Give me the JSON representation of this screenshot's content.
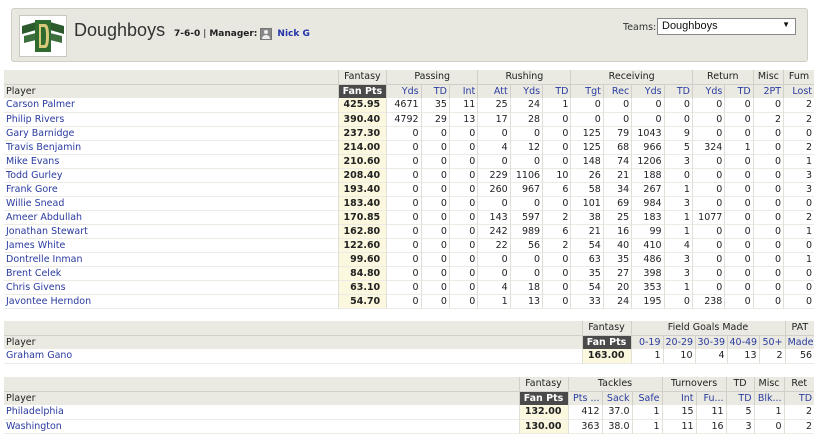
{
  "team": {
    "name": "Doughboys",
    "record": "7-6-0",
    "manager_label": "Manager:",
    "manager_name": "Nick G"
  },
  "teams_selector": {
    "label": "Teams:",
    "selected": "Doughboys"
  },
  "offense": {
    "group_headers": [
      "Fantasy",
      "Passing",
      "Rushing",
      "Receiving",
      "Return",
      "Misc",
      "Fum"
    ],
    "columns": [
      "Player",
      "Fan Pts",
      "Yds",
      "TD",
      "Int",
      "Att",
      "Yds",
      "TD",
      "Tgt",
      "Rec",
      "Yds",
      "TD",
      "Yds",
      "TD",
      "2PT",
      "Lost"
    ],
    "rows": [
      [
        "Carson Palmer",
        "425.95",
        "4671",
        "35",
        "11",
        "25",
        "24",
        "1",
        "0",
        "0",
        "0",
        "0",
        "0",
        "0",
        "0",
        "2"
      ],
      [
        "Philip Rivers",
        "390.40",
        "4792",
        "29",
        "13",
        "17",
        "28",
        "0",
        "0",
        "0",
        "0",
        "0",
        "0",
        "0",
        "2",
        "2"
      ],
      [
        "Gary Barnidge",
        "237.30",
        "0",
        "0",
        "0",
        "0",
        "0",
        "0",
        "125",
        "79",
        "1043",
        "9",
        "0",
        "0",
        "0",
        "0"
      ],
      [
        "Travis Benjamin",
        "214.00",
        "0",
        "0",
        "0",
        "4",
        "12",
        "0",
        "125",
        "68",
        "966",
        "5",
        "324",
        "1",
        "0",
        "2"
      ],
      [
        "Mike Evans",
        "210.60",
        "0",
        "0",
        "0",
        "0",
        "0",
        "0",
        "148",
        "74",
        "1206",
        "3",
        "0",
        "0",
        "0",
        "1"
      ],
      [
        "Todd Gurley",
        "208.40",
        "0",
        "0",
        "0",
        "229",
        "1106",
        "10",
        "26",
        "21",
        "188",
        "0",
        "0",
        "0",
        "0",
        "3"
      ],
      [
        "Frank Gore",
        "193.40",
        "0",
        "0",
        "0",
        "260",
        "967",
        "6",
        "58",
        "34",
        "267",
        "1",
        "0",
        "0",
        "0",
        "3"
      ],
      [
        "Willie Snead",
        "183.40",
        "0",
        "0",
        "0",
        "0",
        "0",
        "0",
        "101",
        "69",
        "984",
        "3",
        "0",
        "0",
        "0",
        "0"
      ],
      [
        "Ameer Abdullah",
        "170.85",
        "0",
        "0",
        "0",
        "143",
        "597",
        "2",
        "38",
        "25",
        "183",
        "1",
        "1077",
        "0",
        "0",
        "2"
      ],
      [
        "Jonathan Stewart",
        "162.80",
        "0",
        "0",
        "0",
        "242",
        "989",
        "6",
        "21",
        "16",
        "99",
        "1",
        "0",
        "0",
        "0",
        "1"
      ],
      [
        "James White",
        "122.60",
        "0",
        "0",
        "0",
        "22",
        "56",
        "2",
        "54",
        "40",
        "410",
        "4",
        "0",
        "0",
        "0",
        "0"
      ],
      [
        "Dontrelle Inman",
        "99.60",
        "0",
        "0",
        "0",
        "0",
        "0",
        "0",
        "63",
        "35",
        "486",
        "3",
        "0",
        "0",
        "0",
        "1"
      ],
      [
        "Brent Celek",
        "84.80",
        "0",
        "0",
        "0",
        "0",
        "0",
        "0",
        "35",
        "27",
        "398",
        "3",
        "0",
        "0",
        "0",
        "0"
      ],
      [
        "Chris Givens",
        "63.10",
        "0",
        "0",
        "0",
        "4",
        "18",
        "0",
        "54",
        "20",
        "353",
        "1",
        "0",
        "0",
        "0",
        "0"
      ],
      [
        "Javontee Herndon",
        "54.70",
        "0",
        "0",
        "0",
        "1",
        "13",
        "0",
        "33",
        "24",
        "195",
        "0",
        "238",
        "0",
        "0",
        "0"
      ]
    ]
  },
  "kicker": {
    "group_headers": [
      "Fantasy",
      "Field Goals Made",
      "PAT"
    ],
    "columns": [
      "Player",
      "Fan Pts",
      "0-19",
      "20-29",
      "30-39",
      "40-49",
      "50+",
      "Made"
    ],
    "rows": [
      [
        "Graham Gano",
        "163.00",
        "1",
        "10",
        "4",
        "13",
        "2",
        "56"
      ]
    ]
  },
  "defense": {
    "group_headers": [
      "Fantasy",
      "Tackles",
      "Turnovers",
      "TD",
      "Misc",
      "Ret"
    ],
    "columns": [
      "Player",
      "Fan Pts",
      "Pts ...",
      "Sack",
      "Safe",
      "Int",
      "Fu...",
      "TD",
      "Blk...",
      "TD"
    ],
    "rows": [
      [
        "Philadelphia",
        "132.00",
        "412",
        "37.0",
        "1",
        "15",
        "11",
        "5",
        "1",
        "2"
      ],
      [
        "Washington",
        "130.00",
        "363",
        "38.0",
        "1",
        "11",
        "16",
        "3",
        "0",
        "2"
      ]
    ]
  }
}
